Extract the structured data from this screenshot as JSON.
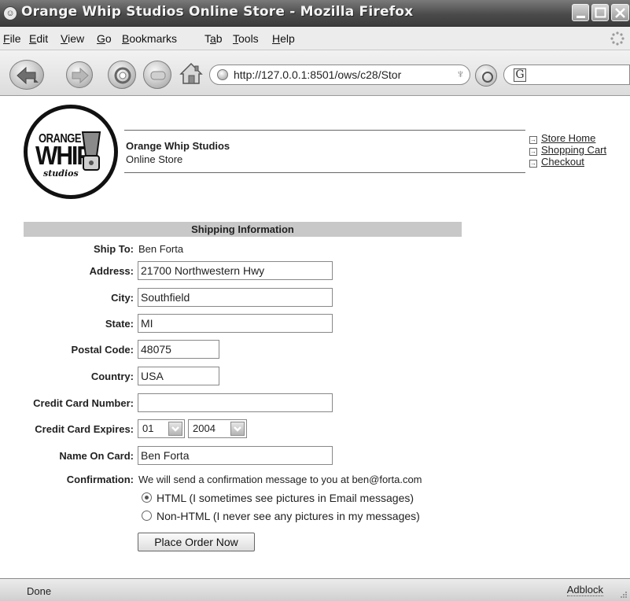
{
  "window": {
    "title": "Orange Whip Studios Online Store - Mozilla Firefox"
  },
  "menu": [
    {
      "key": "F",
      "rest": "ile"
    },
    {
      "key": "E",
      "rest": "dit"
    },
    {
      "key": "V",
      "rest": "iew"
    },
    {
      "key": "G",
      "rest": "o"
    },
    {
      "key": "B",
      "rest": "ookmarks"
    },
    {
      "key": "T",
      "prefix": "",
      "label": "Tab"
    },
    {
      "key": "T",
      "rest": "ools"
    },
    {
      "key": "H",
      "rest": "elp"
    }
  ],
  "menu_labels": [
    "File",
    "Edit",
    "View",
    "Go",
    "Bookmarks",
    "Tab",
    "Tools",
    "Help"
  ],
  "toolbar": {
    "back_icon": "back-arrow-icon",
    "forward_icon": "forward-arrow-icon",
    "reload_icon": "reload-icon",
    "stop_icon": "stop-icon",
    "home_icon": "home-icon",
    "url": "http://127.0.0.1:8501/ows/c28/Stor",
    "search_engine_letter": "G"
  },
  "site": {
    "logo_top": "ORANGE",
    "logo_main": "WHIP",
    "logo_sub": "studios",
    "company_name": "Orange Whip Studios",
    "company_tagline": "Online Store",
    "links": [
      "Store Home",
      "Shopping Cart",
      "Checkout"
    ]
  },
  "form": {
    "section_title": "Shipping Information",
    "ship_to_label": "Ship To:",
    "ship_to_value": "Ben Forta",
    "address_label": "Address:",
    "address_value": "21700 Northwestern Hwy",
    "city_label": "City:",
    "city_value": "Southfield",
    "state_label": "State:",
    "state_value": "MI",
    "postal_label": "Postal Code:",
    "postal_value": "48075",
    "country_label": "Country:",
    "country_value": "USA",
    "cc_number_label": "Credit Card Number:",
    "cc_number_value": "",
    "cc_expires_label": "Credit Card Expires:",
    "cc_month": "01",
    "cc_year": "2004",
    "name_on_card_label": "Name On Card:",
    "name_on_card_value": "Ben Forta",
    "confirmation_label": "Confirmation:",
    "confirmation_text": "We will send a confirmation message to you at ben@forta.com",
    "option_html": "HTML (I sometimes see pictures in Email messages)",
    "option_text": "Non-HTML (I never see any pictures in my messages)",
    "submit_label": "Place Order Now"
  },
  "status": {
    "text": "Done",
    "addon": "Adblock"
  },
  "colors": {
    "section_header_bg": "#c8c8c8",
    "titlebar": "#4b4b4b"
  }
}
